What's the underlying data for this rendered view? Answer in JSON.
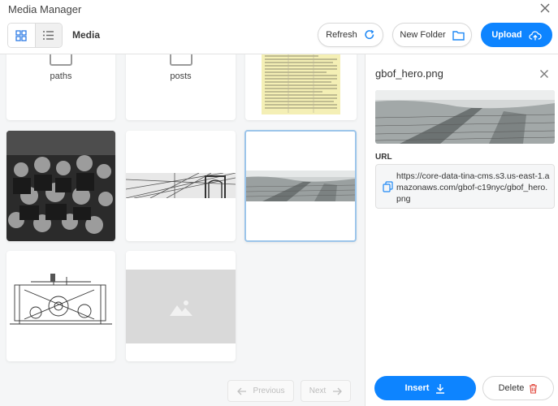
{
  "window": {
    "title": "Media Manager"
  },
  "toolbar": {
    "breadcrumb": "Media",
    "refresh_label": "Refresh",
    "new_folder_label": "New Folder",
    "upload_label": "Upload"
  },
  "grid": {
    "folders": [
      {
        "label": "paths"
      },
      {
        "label": "posts"
      }
    ],
    "items": [
      {
        "name": "newspaper-image",
        "kind": "image"
      },
      {
        "name": "crowd-photo",
        "kind": "image"
      },
      {
        "name": "bridge-image",
        "kind": "image"
      },
      {
        "name": "gbof_hero.png",
        "kind": "image",
        "selected": true
      },
      {
        "name": "printing-press-image",
        "kind": "image"
      },
      {
        "name": "placeholder-image",
        "kind": "placeholder"
      }
    ]
  },
  "pagination": {
    "previous_label": "Previous",
    "next_label": "Next"
  },
  "detail": {
    "filename": "gbof_hero.png",
    "url_label": "URL",
    "url": "https://core-data-tina-cms.s3.us-east-1.amazonaws.com/gbof-c19nyc/gbof_hero.png",
    "insert_label": "Insert",
    "delete_label": "Delete"
  },
  "colors": {
    "primary": "#0d84ff",
    "selected_border": "#9cc5ea",
    "delete_icon": "#e0453a"
  }
}
